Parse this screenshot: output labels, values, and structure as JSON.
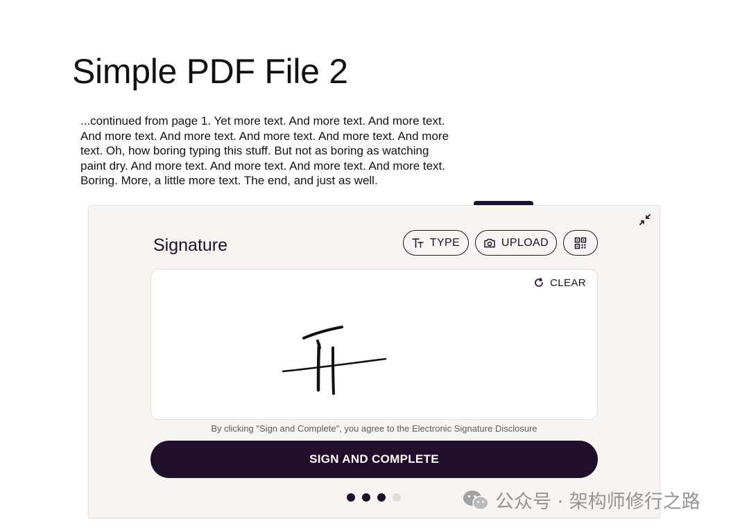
{
  "document": {
    "title": "Simple PDF File 2",
    "body": "...continued from page 1. Yet more text. And more text. And more text.\nAnd more text. And more text. And more text. And more text. And more\ntext. Oh, how boring typing this stuff. But not as boring as watching\npaint dry. And more text. And more text. And more text. And more text.\nBoring.  More, a little more text. The end, and just as well."
  },
  "signature_panel": {
    "title": "Signature",
    "type_label": "TYPE",
    "upload_label": "UPLOAD",
    "clear_label": "CLEAR",
    "disclosure": "By clicking \"Sign and Complete\", you agree to the Electronic Signature Disclosure",
    "sign_label": "SIGN AND COMPLETE",
    "pagination": {
      "total": 4,
      "active": 3
    }
  },
  "icons": {
    "collapse": "collapse-arrows-icon",
    "type": "text-size-icon",
    "upload": "camera-icon",
    "qr": "qr-code-icon",
    "clear": "refresh-icon"
  },
  "colors": {
    "accent": "#1f0f2a",
    "panel_bg": "#f8f4f1",
    "dot_inactive": "#e0dcd9"
  },
  "watermark": {
    "text": "公众号 · 架构师修行之路"
  }
}
